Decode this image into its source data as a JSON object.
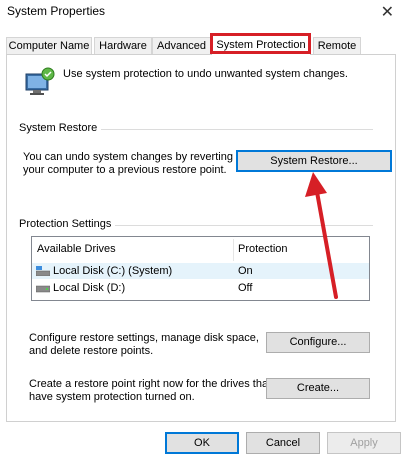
{
  "window": {
    "title": "System Properties",
    "close_glyph": "✕"
  },
  "tabs": [
    {
      "label": "Computer Name"
    },
    {
      "label": "Hardware"
    },
    {
      "label": "Advanced"
    },
    {
      "label": "System Protection",
      "active": true
    },
    {
      "label": "Remote"
    }
  ],
  "intro": {
    "text": "Use system protection to undo unwanted system changes.",
    "icon": "system-computer-icon"
  },
  "system_restore": {
    "group_label": "System Restore",
    "description_line1": "You can undo system changes by reverting",
    "description_line2": "your computer to a previous restore point.",
    "button_label": "System Restore..."
  },
  "protection_settings": {
    "group_label": "Protection Settings",
    "columns": [
      "Available Drives",
      "Protection"
    ],
    "drives": [
      {
        "name": "Local Disk (C:) (System)",
        "protection": "On",
        "icon": "system-drive-icon",
        "selected": true
      },
      {
        "name": "Local Disk (D:)",
        "protection": "Off",
        "icon": "drive-icon",
        "selected": false
      }
    ],
    "configure_line1": "Configure restore settings, manage disk space,",
    "configure_line2": "and delete restore points.",
    "configure_button": "Configure...",
    "create_line1": "Create a restore point right now for the drives that",
    "create_line2": "have system protection turned on.",
    "create_button": "Create..."
  },
  "footer": {
    "ok": "OK",
    "cancel": "Cancel",
    "apply": "Apply"
  },
  "colors": {
    "highlight": "#d61f26",
    "accent": "#0078d7",
    "selected_row": "#e5f3fb"
  }
}
